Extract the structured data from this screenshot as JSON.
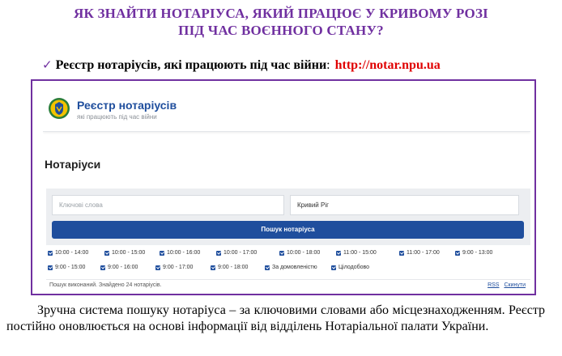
{
  "title": {
    "line1": "ЯК ЗНАЙТИ НОТАРІУСА, ЯКИЙ ПРАЦЮЄ У КРИВОМУ РОЗІ",
    "line2": "ПІД ЧАС ВОЄННОГО СТАНУ?"
  },
  "registry": {
    "check_icon": "✓",
    "label": "Реєстр  нотаріусів, які працюють під час війни",
    "colon": ":",
    "url": "http://notar.npu.ua"
  },
  "site": {
    "name": "Реєстр нотаріусів",
    "subtitle": "які працюють під час війни",
    "heading": "Нотаріуси",
    "search": {
      "keywords_placeholder": "Ключові слова",
      "city_value": "Кривий Ріг",
      "button_label": "Пошук нотаріуса"
    },
    "filters_row1": [
      "10:00 - 14:00",
      "10:00 - 15:00",
      "10:00 - 16:00",
      "10:00 - 17:00",
      "10:00 - 18:00",
      "11:00 - 15:00",
      "11:00 - 17:00",
      "9:00 - 13:00"
    ],
    "filters_row2": [
      "9:00 - 15:00",
      "9:00 - 16:00",
      "9:00 - 17:00",
      "9:00 - 18:00",
      "За домовленістю",
      "Цілодобово"
    ],
    "status": "Пошук виконаний. Знайдено 24 нотаріусів.",
    "link_rss": "RSS",
    "link_reset": "Скинути"
  },
  "description": "Зручна система пошуку нотаріуса – за ключовими словами або місцезнаходженням. Реєстр постійно оновлюється на основі інформації від відділень Нотаріальної палати України.",
  "colors": {
    "title_purple": "#7030a0",
    "url_red": "#e00000",
    "site_blue": "#1f4e9d"
  }
}
